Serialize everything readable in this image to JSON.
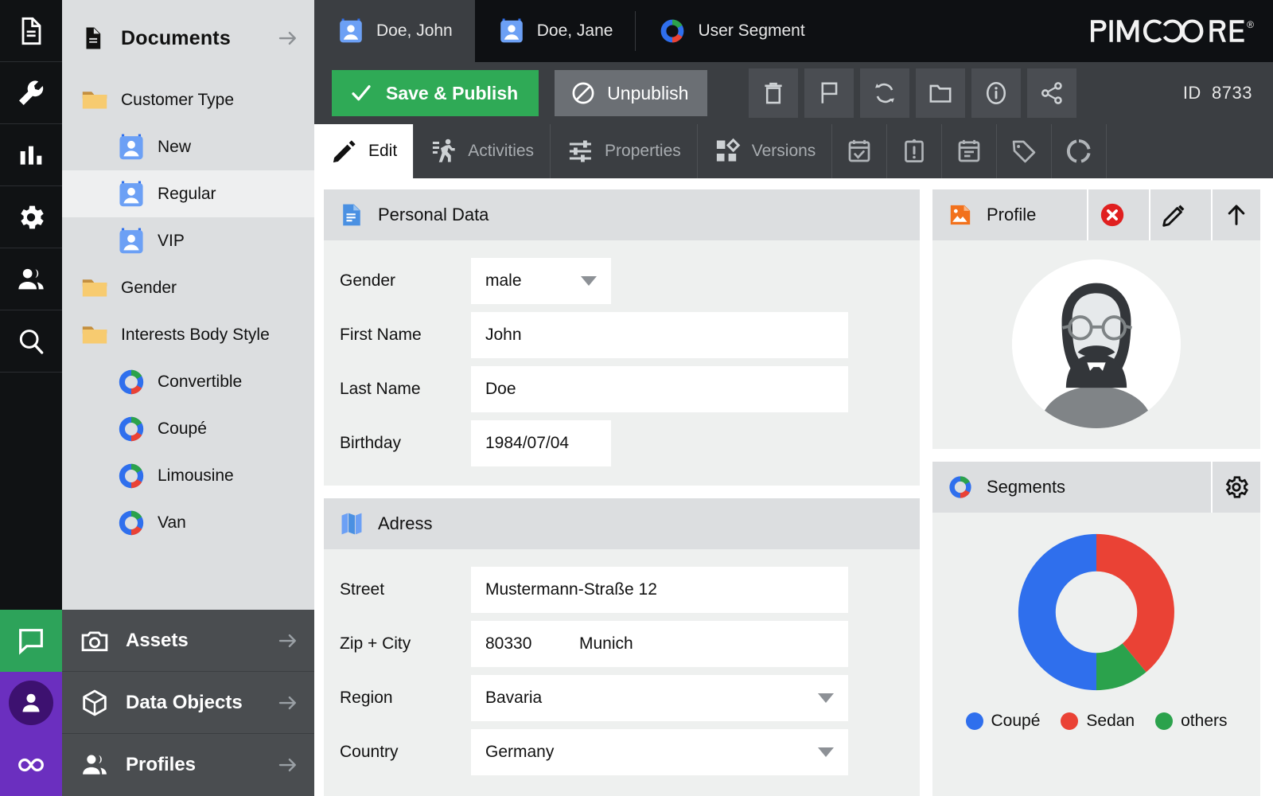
{
  "brand": {
    "name": "PIMCORE",
    "registered": "®"
  },
  "rail": {
    "items": [
      {
        "name": "documents-icon",
        "label": "Documents"
      },
      {
        "name": "tools-icon",
        "label": "Tools"
      },
      {
        "name": "reports-icon",
        "label": "Reports"
      },
      {
        "name": "settings-icon",
        "label": "Settings"
      },
      {
        "name": "customers-icon",
        "label": "Customers"
      },
      {
        "name": "search-icon",
        "label": "Search"
      }
    ],
    "bottom": [
      {
        "name": "chat-icon",
        "label": "Chat",
        "color": "#2da35a"
      },
      {
        "name": "user-avatar-icon",
        "label": "Profile",
        "color": "#6b2fbf"
      },
      {
        "name": "infinity-icon",
        "label": "Infinity",
        "color": "#6b2fbf"
      }
    ]
  },
  "sidebar": {
    "header": {
      "title": "Documents",
      "icon": "document-icon"
    },
    "tree": [
      {
        "label": "Customer Type",
        "icon": "folder-icon",
        "level": 1,
        "selected": false
      },
      {
        "label": "New",
        "icon": "customer-icon",
        "level": 2,
        "selected": false
      },
      {
        "label": "Regular",
        "icon": "customer-icon",
        "level": 2,
        "selected": true
      },
      {
        "label": "VIP",
        "icon": "customer-icon",
        "level": 2,
        "selected": false
      },
      {
        "label": "Gender",
        "icon": "folder-icon",
        "level": 1,
        "selected": false
      },
      {
        "label": "Interests Body Style",
        "icon": "folder-icon",
        "level": 1,
        "selected": false
      },
      {
        "label": "Convertible",
        "icon": "segment-icon",
        "level": 2,
        "selected": false
      },
      {
        "label": "Coupé",
        "icon": "segment-icon",
        "level": 2,
        "selected": false
      },
      {
        "label": "Limousine",
        "icon": "segment-icon",
        "level": 2,
        "selected": false
      },
      {
        "label": "Van",
        "icon": "segment-icon",
        "level": 2,
        "selected": false
      }
    ],
    "sections": [
      {
        "label": "Assets",
        "icon": "camera-icon"
      },
      {
        "label": "Data Objects",
        "icon": "cube-icon"
      },
      {
        "label": "Profiles",
        "icon": "people-icon"
      }
    ]
  },
  "tabs": [
    {
      "label": "Doe, John",
      "icon": "customer-icon",
      "active": true
    },
    {
      "label": "Doe, Jane",
      "icon": "customer-icon",
      "active": false
    },
    {
      "label": "User Segment",
      "icon": "segment-icon",
      "active": false
    }
  ],
  "toolbar": {
    "save_label": "Save & Publish",
    "unpublish_label": "Unpublish",
    "id_label": "ID",
    "id_value": "8733",
    "icons": [
      {
        "name": "delete-icon"
      },
      {
        "name": "flag-icon"
      },
      {
        "name": "reload-icon"
      },
      {
        "name": "folder-open-icon"
      },
      {
        "name": "info-icon"
      },
      {
        "name": "share-icon"
      }
    ]
  },
  "edit_tabs": [
    {
      "label": "Edit",
      "icon": "pencil-icon",
      "active": true
    },
    {
      "label": "Activities",
      "icon": "activities-icon",
      "active": false
    },
    {
      "label": "Properties",
      "icon": "sliders-icon",
      "active": false
    },
    {
      "label": "Versions",
      "icon": "versions-icon",
      "active": false
    },
    {
      "label": "",
      "icon": "calendar-check-icon",
      "active": false
    },
    {
      "label": "",
      "icon": "clipboard-alert-icon",
      "active": false
    },
    {
      "label": "",
      "icon": "calendar-list-icon",
      "active": false
    },
    {
      "label": "",
      "icon": "tag-icon",
      "active": false
    },
    {
      "label": "",
      "icon": "donut-icon",
      "active": false
    }
  ],
  "personal_data": {
    "title": "Personal Data",
    "icon": "doc-blue-icon",
    "fields": {
      "gender_label": "Gender",
      "gender_value": "male",
      "first_name_label": "First Name",
      "first_name_value": "John",
      "last_name_label": "Last Name",
      "last_name_value": "Doe",
      "birthday_label": "Birthday",
      "birthday_value": "1984/07/04"
    }
  },
  "address": {
    "title": "Adress",
    "icon": "map-icon",
    "fields": {
      "street_label": "Street",
      "street_value": "Mustermann-Straße 12",
      "zipcity_label": "Zip + City",
      "zip_value": "80330",
      "city_value": "Munich",
      "region_label": "Region",
      "region_value": "Bavaria",
      "country_label": "Country",
      "country_value": "Germany"
    }
  },
  "profile": {
    "title": "Profile",
    "icon": "image-orange-icon",
    "actions": [
      {
        "name": "remove-image-button",
        "icon": "close-circle-icon"
      },
      {
        "name": "edit-image-button",
        "icon": "pencil-icon"
      },
      {
        "name": "upload-image-button",
        "icon": "arrow-up-icon"
      }
    ]
  },
  "segments": {
    "title": "Segments",
    "icon": "segment-icon",
    "settings_icon": "gear-icon"
  },
  "chart_data": {
    "type": "pie",
    "title": "Segments",
    "categories": [
      "Coupé",
      "Sedan",
      "others"
    ],
    "values": [
      50,
      39,
      11
    ],
    "colors": [
      "#2f6fed",
      "#ea4235",
      "#2ba24c"
    ],
    "legend_position": "bottom",
    "donut": true,
    "inner_radius_ratio": 0.52
  }
}
